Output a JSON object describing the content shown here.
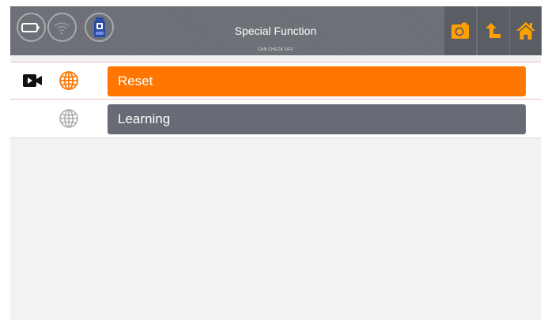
{
  "header": {
    "title": "Special Function",
    "subtitle": "CAN CHECK OFF"
  },
  "status_icons": [
    "battery-icon",
    "wifi-icon",
    "obd-device-icon"
  ],
  "toolbar": {
    "icons": [
      "screenshot-icon",
      "back-icon",
      "home-icon"
    ]
  },
  "functions": [
    {
      "label": "Reset",
      "selected": true,
      "icons": [
        "video-icon",
        "globe-icon"
      ]
    },
    {
      "label": "Learning",
      "selected": false,
      "icons": [
        "globe-icon"
      ]
    }
  ],
  "colors": {
    "accent": "#ff7600",
    "header_bg": "#6b6e74",
    "item_bg": "#686b75",
    "toolbar_icon": "#ffa000"
  }
}
